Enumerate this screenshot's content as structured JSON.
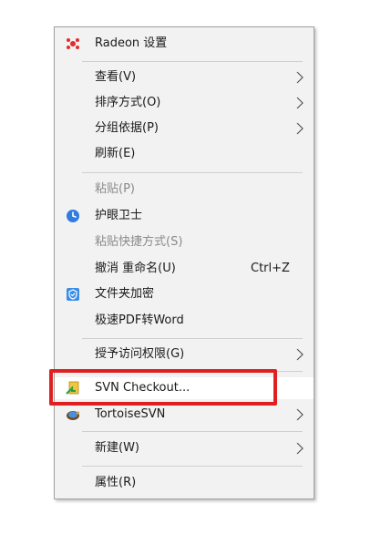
{
  "menu": {
    "items": [
      {
        "label": "Radeon 设置",
        "icon": "radeon-icon"
      },
      {
        "label": "查看(V)",
        "submenu": true
      },
      {
        "label": "排序方式(O)",
        "submenu": true
      },
      {
        "label": "分组依据(P)",
        "submenu": true
      },
      {
        "label": "刷新(E)"
      },
      {
        "label": "粘贴(P)",
        "disabled": true
      },
      {
        "label": "护眼卫士",
        "icon": "eye-guard-icon"
      },
      {
        "label": "粘贴快捷方式(S)",
        "disabled": true
      },
      {
        "label": "撤消 重命名(U)",
        "shortcut": "Ctrl+Z"
      },
      {
        "label": "文件夹加密",
        "icon": "shield-icon"
      },
      {
        "label": "极速PDF转Word"
      },
      {
        "label": "授予访问权限(G)",
        "submenu": true
      },
      {
        "label": "SVN Checkout...",
        "icon": "svn-checkout-icon",
        "highlighted": true
      },
      {
        "label": "TortoiseSVN",
        "icon": "tortoisesvn-icon",
        "submenu": true
      },
      {
        "label": "新建(W)",
        "submenu": true
      },
      {
        "label": "属性(R)"
      }
    ]
  },
  "colors": {
    "menu_bg": "#f2f2f2",
    "highlight_border": "#e02020",
    "disabled_text": "#8a8a8a"
  }
}
